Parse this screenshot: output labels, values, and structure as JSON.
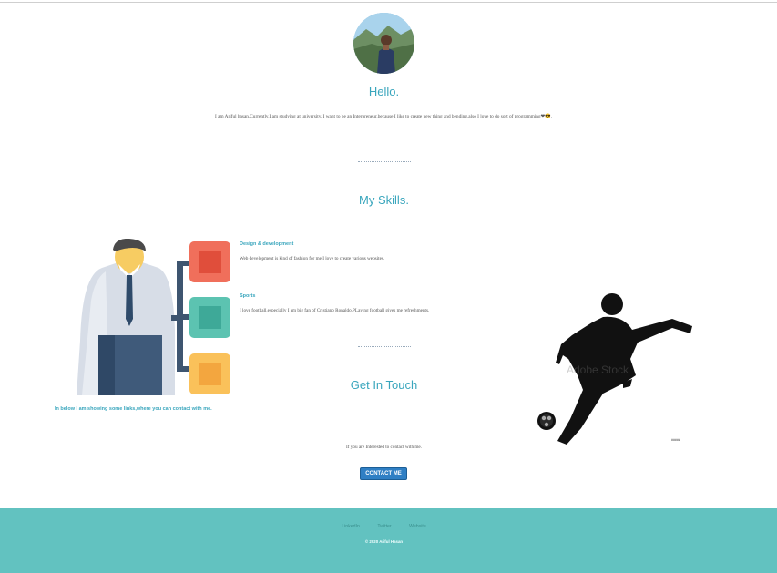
{
  "profile": {
    "greeting": "Hello.",
    "intro": "I am Ariful hasan.Currently,I am studying at university. I want to be an Interpreneur,because I like to create new thing and bending,also I love to do sort of programming❤😎."
  },
  "skills": {
    "title": "My Skills.",
    "items": [
      {
        "heading": "Design & development",
        "text": "Web development is kind of fashion for me,I love to create various websites."
      },
      {
        "heading": "Sports",
        "text": "I love football,especially I am big fan of Cristiano Ronaldo.PLaying football gives me refreshments."
      }
    ]
  },
  "contact": {
    "title": "Get In Touch",
    "links_note": "In below I am showing some links,where you can contact with me.",
    "text": "If you are Interested to contact with me.",
    "button_label": "CONTACT ME",
    "image_caption": "#####"
  },
  "footer": {
    "links": [
      "LinkedIn",
      "Twitter",
      "Website"
    ],
    "copyright": "© 2020 Ariful Hasan"
  },
  "colors": {
    "accent": "#3aa6bd",
    "footer_bg": "#62c2c0",
    "button": "#2f7fc4"
  }
}
